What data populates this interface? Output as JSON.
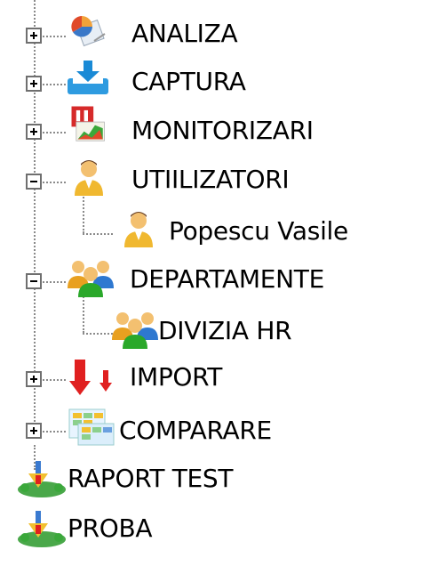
{
  "tree": {
    "nodes": [
      {
        "id": "analiza",
        "label": "ANALIZA",
        "icon": "pie-chart-icon",
        "state": "collapsed"
      },
      {
        "id": "captura",
        "label": "CAPTURA",
        "icon": "download-tray-icon",
        "state": "collapsed"
      },
      {
        "id": "monitorizari",
        "label": "MONITORIZARI",
        "icon": "monitor-chart-icon",
        "state": "collapsed"
      },
      {
        "id": "utilizatori",
        "label": "UTIILIZATORI",
        "icon": "user-icon",
        "state": "expanded",
        "children": [
          {
            "id": "popescu",
            "label": "Popescu Vasile",
            "icon": "user-icon"
          }
        ]
      },
      {
        "id": "departamente",
        "label": "DEPARTAMENTE",
        "icon": "group-icon",
        "state": "expanded",
        "children": [
          {
            "id": "divizia-hr",
            "label": "DIVIZIA HR",
            "icon": "group-icon"
          }
        ]
      },
      {
        "id": "import",
        "label": "IMPORT",
        "icon": "import-arrows-icon",
        "state": "collapsed"
      },
      {
        "id": "comparare",
        "label": "COMPARARE",
        "icon": "compare-icon",
        "state": "collapsed"
      },
      {
        "id": "raport-test",
        "label": "RAPORT TEST",
        "icon": "report-icon"
      },
      {
        "id": "proba",
        "label": "PROBA",
        "icon": "report-icon"
      }
    ]
  }
}
